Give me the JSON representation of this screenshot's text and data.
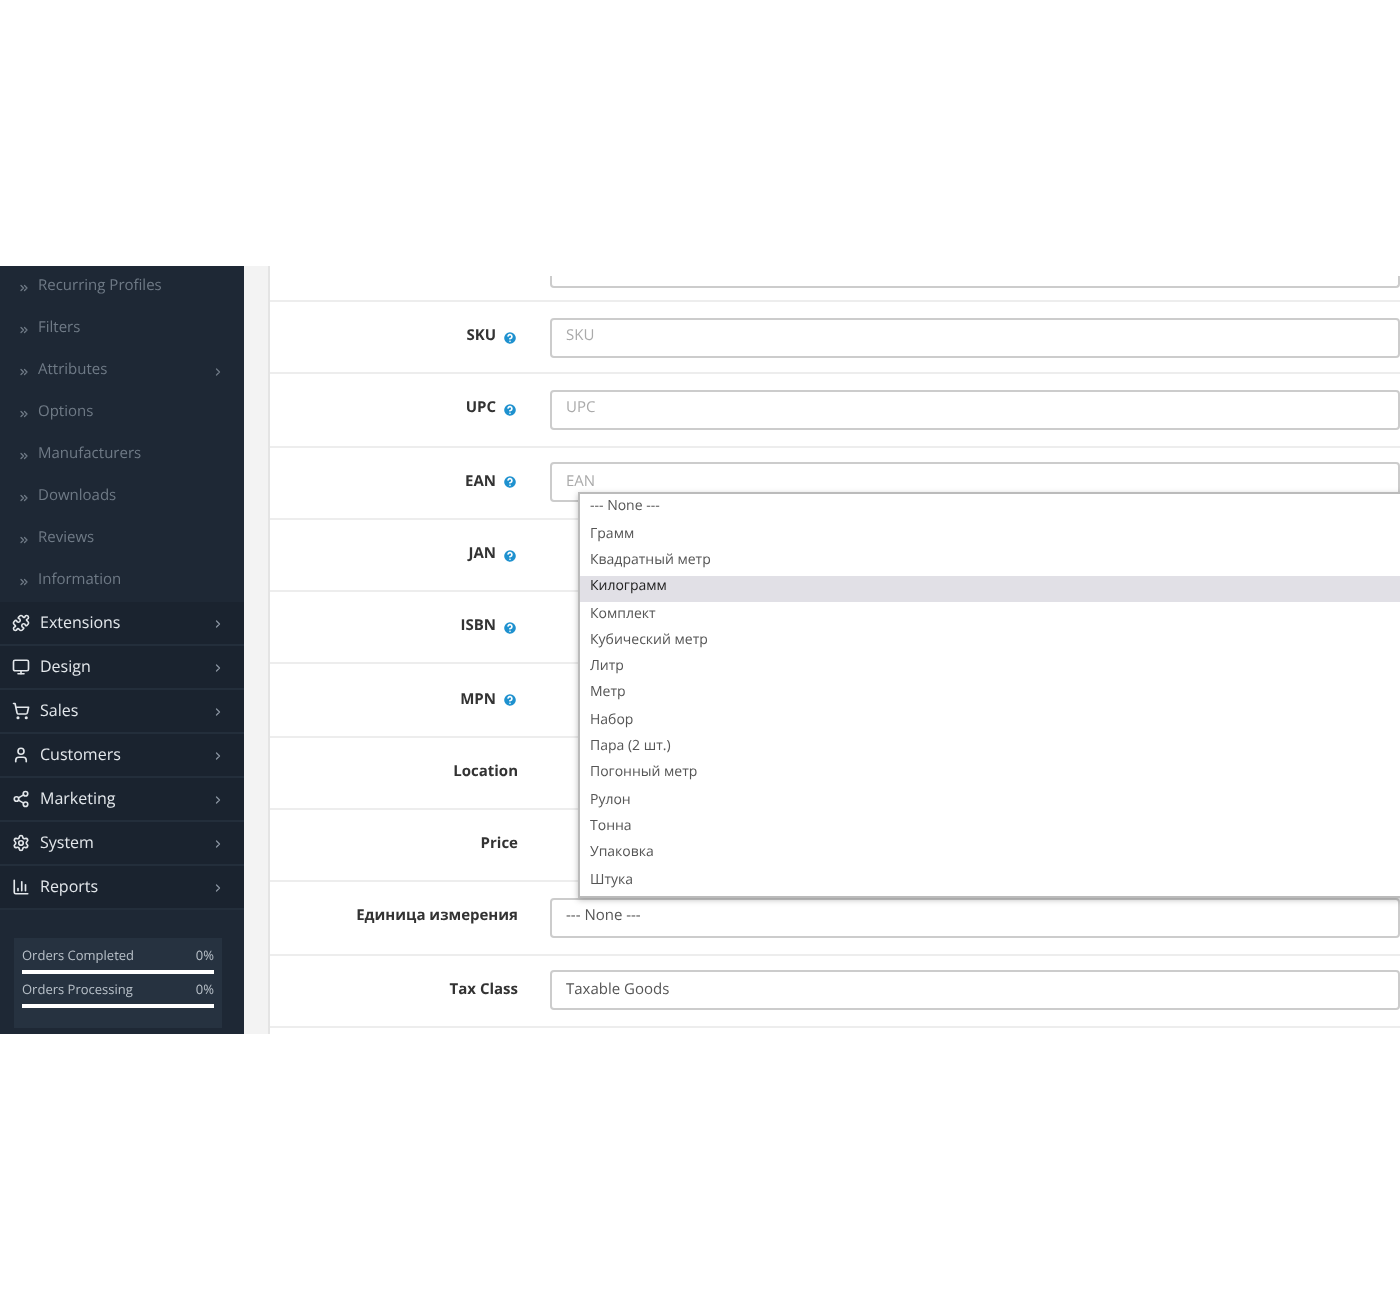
{
  "sidebar": {
    "subitems": [
      {
        "label": "Recurring Profiles",
        "has_children": false
      },
      {
        "label": "Filters",
        "has_children": false
      },
      {
        "label": "Attributes",
        "has_children": true
      },
      {
        "label": "Options",
        "has_children": false
      },
      {
        "label": "Manufacturers",
        "has_children": false
      },
      {
        "label": "Downloads",
        "has_children": false
      },
      {
        "label": "Reviews",
        "has_children": false
      },
      {
        "label": "Information",
        "has_children": false
      }
    ],
    "items": [
      {
        "label": "Extensions"
      },
      {
        "label": "Design"
      },
      {
        "label": "Sales"
      },
      {
        "label": "Customers"
      },
      {
        "label": "Marketing"
      },
      {
        "label": "System"
      },
      {
        "label": "Reports"
      }
    ],
    "stats": [
      {
        "label": "Orders Completed",
        "value": "0%",
        "level": 0
      },
      {
        "label": "Orders Processing",
        "value": "0%",
        "level": 0
      }
    ]
  },
  "form": {
    "rows": [
      {
        "label": "SKU",
        "help": true,
        "field": {
          "placeholder": "SKU"
        }
      },
      {
        "label": "UPC",
        "help": true,
        "field": {
          "placeholder": "UPC"
        }
      },
      {
        "label": "EAN",
        "help": true,
        "field": {
          "placeholder": "EAN"
        }
      },
      {
        "label": "JAN",
        "help": true
      },
      {
        "label": "ISBN",
        "help": true
      },
      {
        "label": "MPN",
        "help": true
      },
      {
        "label": "Location",
        "help": false
      },
      {
        "label": "Price",
        "help": false
      },
      {
        "label": "Единица измерения",
        "help": false,
        "field": {
          "value": "--- None ---"
        }
      },
      {
        "label": "Tax Class",
        "help": false,
        "field": {
          "value": "Taxable Goods"
        }
      }
    ]
  },
  "dropdown": {
    "options": [
      {
        "label": "--- None ---",
        "selected": false
      },
      {
        "label": "Грамм",
        "selected": false
      },
      {
        "label": "Квадратный метр",
        "selected": false
      },
      {
        "label": "Килограмм",
        "selected": true
      },
      {
        "label": "Комплект",
        "selected": false
      },
      {
        "label": "Кубический метр",
        "selected": false
      },
      {
        "label": "Литр",
        "selected": false
      },
      {
        "label": "Метр",
        "selected": false
      },
      {
        "label": "Набор",
        "selected": false
      },
      {
        "label": "Пара (2 шт.)",
        "selected": false
      },
      {
        "label": "Погонный метр",
        "selected": false
      },
      {
        "label": "Рулон",
        "selected": false
      },
      {
        "label": "Тонна",
        "selected": false
      },
      {
        "label": "Упаковка",
        "selected": false
      },
      {
        "label": "Штука",
        "selected": false
      }
    ]
  }
}
